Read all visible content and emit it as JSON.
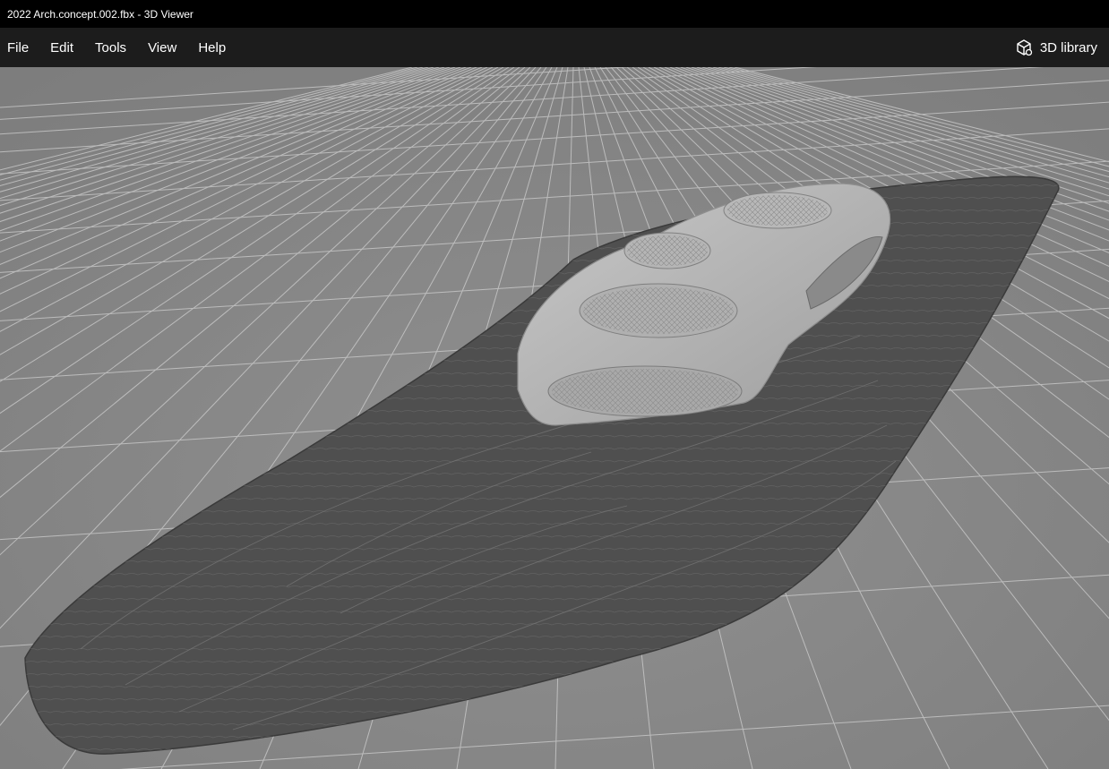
{
  "window": {
    "title": "2022 Arch.concept.002.fbx - 3D Viewer"
  },
  "menu": {
    "items": [
      "File",
      "Edit",
      "Tools",
      "View",
      "Help"
    ]
  },
  "toolbar": {
    "library_label": "3D library",
    "library_icon": "cube-icon"
  },
  "viewport": {
    "background_color": "#8a8a8a",
    "grid_color": "#d4d4d4",
    "model_base_color": "#4a4a4a",
    "model_top_color": "#bdbdbd"
  }
}
